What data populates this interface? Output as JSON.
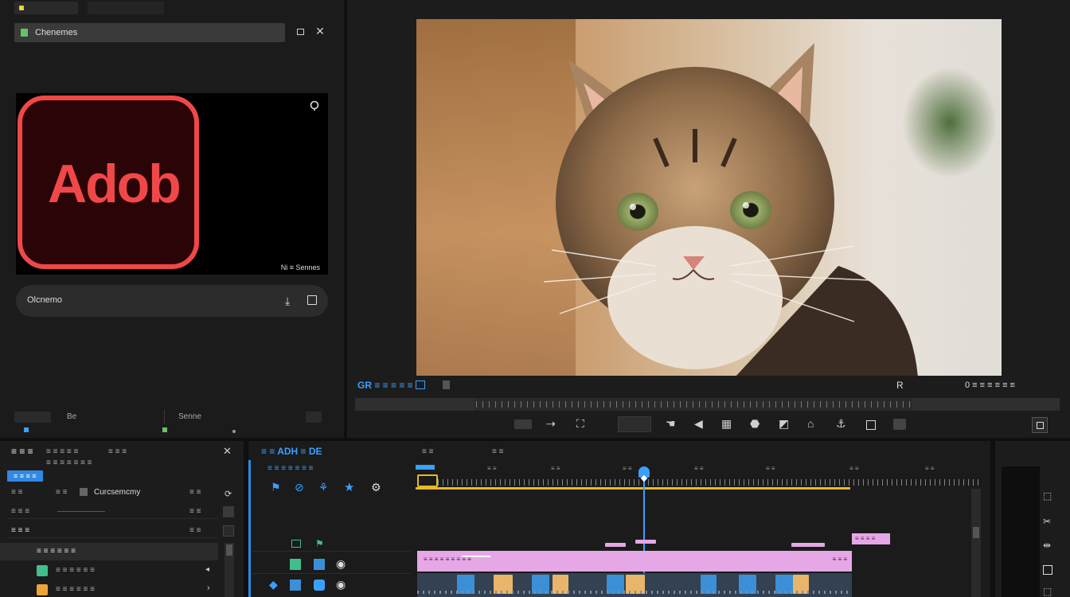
{
  "project": {
    "tab_label": "",
    "search_label": "Chenemes",
    "logo_text": "Adob",
    "thumb_caption": "Ni ≡ Sennes",
    "field_label": "Olcnemo",
    "bottom_left": "Be",
    "bottom_mid": "Senne"
  },
  "program": {
    "timecode": "GR ≡ ≡ ≡ ≡ ≡",
    "right_code": "0 ≡ ≡ ≡ ≡ ≡ ≡",
    "mark_label": "R",
    "transport_icons": [
      "marker-in-icon",
      "arrow-icon",
      "lift-icon",
      "extract-icon",
      "hand-icon",
      "play-icon",
      "step-icon",
      "loop-icon",
      "overwrite-icon",
      "insert-icon",
      "export-icon",
      "square-icon",
      "camera-icon"
    ]
  },
  "effects": {
    "title": "≡ ≡ ≡",
    "subtitle": "≡ ≡ ≡ ≡ ≡ ≡ ≡",
    "badge": "≡ ≡ ≡ ≡",
    "col1": "≡ ≡",
    "col2": "≡ ≡",
    "col3": "Curcsemcmy",
    "row1": "≡ ≡ ≡",
    "row2": "≡ ≡ ≡",
    "item1": "≡ ≡ ≡ ≡ ≡ ≡",
    "item2": "≡ ≡ ≡ ≡ ≡ ≡",
    "item3": "≡ ≡ ≡ ≡ ≡ ≡"
  },
  "timeline": {
    "title": "≡ ≡ ADH ≡ DE",
    "subtitle": "≡ ≡ ≡ ≡ ≡ ≡ ≡",
    "tab2": "≡ ≡",
    "tab3": "≡ ≡",
    "clip_label": "≡ ≡ ≡ ≡ ≡ ≡ ≡ ≡ ≡",
    "clip_end": "≡ ≡ ≡",
    "marker_label": "≡ ≡ ≡ ≡"
  },
  "colors": {
    "accent_blue": "#2f89e6",
    "playhead": "#3aa0ff",
    "work_area": "#e8b923",
    "clip_pink": "#e6a7e6",
    "clip_blue": "#3b8fd6",
    "clip_orange": "#e9b56a",
    "logo_red": "#f04848"
  }
}
